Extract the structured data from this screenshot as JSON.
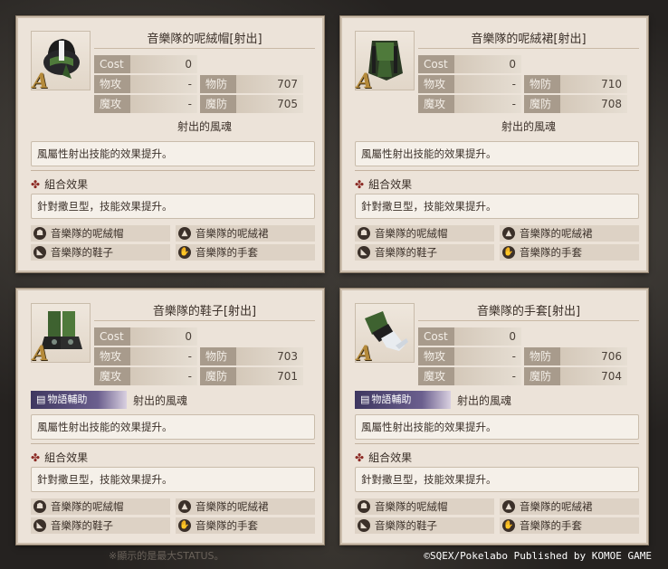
{
  "labels": {
    "cost": "Cost",
    "patk": "物攻",
    "matk": "魔攻",
    "pdef": "物防",
    "mdef": "魔防",
    "combo_title": "組合效果",
    "story_tag": "物語輔助"
  },
  "cards": [
    {
      "title": "音樂隊的呢絨帽[射出]",
      "rank": "A",
      "cost": "0",
      "patk": "-",
      "matk": "-",
      "pdef": "707",
      "mdef": "705",
      "soul_name": "射出的風魂",
      "soul_desc": "風屬性射出技能的效果提升。",
      "combo_desc": "針對撒旦型，技能效果提升。"
    },
    {
      "title": "音樂隊的呢絨裙[射出]",
      "rank": "A",
      "cost": "0",
      "patk": "-",
      "matk": "-",
      "pdef": "710",
      "mdef": "708",
      "soul_name": "射出的風魂",
      "soul_desc": "風屬性射出技能的效果提升。",
      "combo_desc": "針對撒旦型，技能效果提升。"
    },
    {
      "title": "音樂隊的鞋子[射出]",
      "rank": "A",
      "cost": "0",
      "patk": "-",
      "matk": "-",
      "pdef": "703",
      "mdef": "701",
      "soul_name": "射出的風魂",
      "soul_desc": "風屬性射出技能的效果提升。",
      "combo_desc": "針對撒旦型，技能效果提升。"
    },
    {
      "title": "音樂隊的手套[射出]",
      "rank": "A",
      "cost": "0",
      "patk": "-",
      "matk": "-",
      "pdef": "706",
      "mdef": "704",
      "soul_name": "射出的風魂",
      "soul_desc": "風屬性射出技能的效果提升。",
      "combo_desc": "針對撒旦型，技能效果提升。"
    }
  ],
  "set_pieces": [
    "音樂隊的呢絨帽",
    "音樂隊的呢絨裙",
    "音樂隊的鞋子",
    "音樂隊的手套"
  ],
  "footer_note": "※顯示的是最大STATUS。",
  "copyright": "©SQEX/Pokelabo Published by KOMOE GAME",
  "icons": {
    "combo": "cross-emblem-icon",
    "story": "book-icon",
    "pieces": [
      "hat-icon",
      "skirt-icon",
      "shoes-icon",
      "gloves-icon"
    ]
  }
}
